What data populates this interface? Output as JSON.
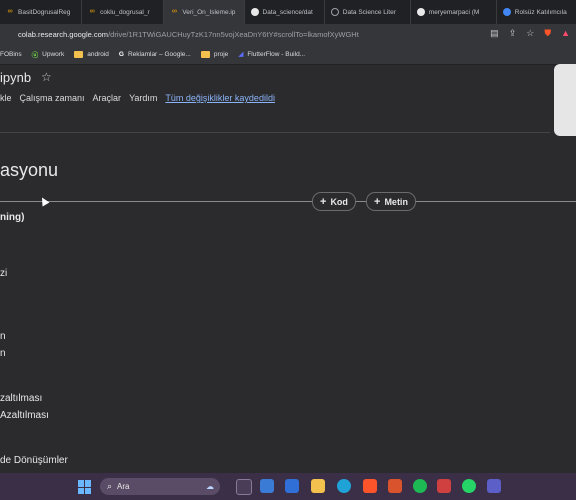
{
  "browser": {
    "tabs": [
      {
        "label": "BasitDogrusalReg",
        "icon": "colab-icon",
        "color": "#f9ab00"
      },
      {
        "label": "coklu_dogrusal_r",
        "icon": "colab-icon",
        "color": "#f9ab00"
      },
      {
        "label": "Veri_On_Isleme.ip",
        "icon": "colab-icon",
        "color": "#f9ab00"
      },
      {
        "label": "Data_science/dat",
        "icon": "github-icon",
        "color": "#e8e8e8"
      },
      {
        "label": "Data Science Liter",
        "icon": "globe-icon",
        "color": "#9aa0a6"
      },
      {
        "label": "meryemarpaci (M",
        "icon": "github-icon",
        "color": "#e8e8e8"
      },
      {
        "label": "Rolsüz Katılımcıla",
        "icon": "meet-icon",
        "color": "#4285f4"
      }
    ],
    "url_main": "colab.research.google.com",
    "url_rest": "/drive/1R1TWiGAUCHuyTzK17nn5vojXeaDnY6tY#scrollTo=lkamofXyWGHt",
    "bookmarks": [
      {
        "label": "FOBins",
        "icon": "bookmark-icon"
      },
      {
        "label": "Upwork",
        "icon": "upwork-icon"
      },
      {
        "label": "android",
        "icon": "folder-icon"
      },
      {
        "label": "Reklamlar – Google...",
        "icon": "google-icon"
      },
      {
        "label": "proje",
        "icon": "folder-icon"
      },
      {
        "label": "FlutterFlow - Build...",
        "icon": "flutterflow-icon"
      }
    ]
  },
  "colab": {
    "doc_title": "ipynb",
    "menu": [
      "kle",
      "Çalışma zamanı",
      "Araçlar",
      "Yardım"
    ],
    "saved_status": "Tüm değişiklikler kaydedildi",
    "heading": "asyonu",
    "add_code": "Kod",
    "add_text": "Metin",
    "toc_items": [
      {
        "text": "ning)",
        "bold": true
      },
      {
        "text": "zi",
        "bold": false
      },
      {
        "text": "n",
        "bold": false
      },
      {
        "text": "n",
        "bold": false
      },
      {
        "text": "zaltılması",
        "bold": false
      },
      {
        "text": "Azaltılması",
        "bold": false
      },
      {
        "text": "de Dönüşümler",
        "bold": false
      }
    ]
  },
  "taskbar": {
    "search_placeholder": "Ara"
  }
}
